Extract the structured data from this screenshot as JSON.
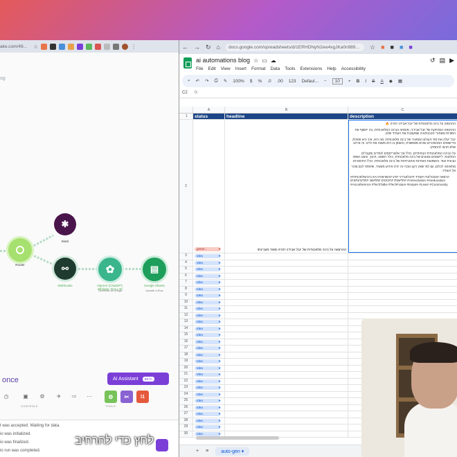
{
  "left": {
    "url_fragment": "ake.com/49...",
    "blog_fragment": "og",
    "nodes": {
      "router_label": "Router",
      "slack_label": "Slack",
      "pink_label": "Webhooks",
      "openai_label": "OpenAI (ChatGPT, Whisper, DALL-E)",
      "openai_sub": "Generate an image",
      "sheets_label": "Google Sheets",
      "sheets_sub": "Update a Row"
    },
    "run_once": "once",
    "ai_assistant": "AI Assistant",
    "beta": "BETA",
    "controls_label": "CONTROLS",
    "tools_label": "TOOLS",
    "log": [
      "t was accepted. Waiting for data.",
      "io was initialized.",
      "io was finalized.",
      "io run was completed."
    ]
  },
  "right": {
    "url": "docs.google.com/spreadsheets/d/1ERHDNyN2ew4xgJKa0n989...",
    "doc_title": "ai automations blog",
    "menus": [
      "File",
      "Edit",
      "View",
      "Insert",
      "Format",
      "Data",
      "Tools",
      "Extensions",
      "Help",
      "Accessibility"
    ],
    "zoom": "100%",
    "font": "Defaul...",
    "font_size": "10",
    "cell_ref": "C2",
    "fx": "fx",
    "columns": [
      "A",
      "B",
      "C"
    ],
    "headers": {
      "status": "status",
      "headline": "headline",
      "description": "description"
    },
    "row2_status": "gener...",
    "row2_headline": "ההרצאה על בינה מלאכותית של יובל אבידני תהיה מאוד מעניינת!",
    "desc_paragraphs": [
      "ההרצאה על בינה מלאכותית של יובל אבידני תהיה 🔥",
      "ההרצאה המרתקת של יובל אבידני, מומחה הבינה המלאכותית, בה יחשוף את הסודות מאחורי הטכנולוגיה שמעצבת את העתיד שלנו.",
      "יובל יעלה את סוד העולם המסעיר של בינה מלאכותית: מה היא, איך היא פועלת, והיישומים המהפכניים שהיא מאפשרת, והאופן בו היא משנה את חיינו. זה אירוע שלא תרצו להחמיץ!",
      "על הבינה המלאכותית הבסיסיים, כולל איך אלגוריתמים לומדים ומקבלים החלטות. ליישומים מגוונים של בינה מלאכותית, כולל רפואה, חינוך, עיצוב ושפה טבעית ועוד. והשפעות האתיות והחברתיות של בינה מלאכותית, כולל הזדמנויות.",
      "מתאימה לכולם, גם למי שאין רקע טכני! זה יהיה אירוע מעשיר, שיפתח לכם צוהר אל העתיד.",
      "#בינהמלאכותית #AI #הרצאה #טכנולוגיה #עתיד #יובלאבידני #דע #השראה #חדשנות #רובוטים #מחשוב #מדעהנתונים #AIrevolution #AIeducation #AIconference #TechTalks #TechFuture #Inspire #Learn #Community"
    ],
    "chip_idea": "Idea",
    "row_numbers": [
      "1",
      "2",
      "3",
      "4",
      "5",
      "6",
      "7",
      "8",
      "9",
      "10",
      "11",
      "12",
      "13",
      "14",
      "15",
      "16",
      "17",
      "18",
      "19",
      "20",
      "21",
      "22",
      "23",
      "24",
      "25",
      "26",
      "27",
      "28",
      "29",
      "30"
    ],
    "sheet_tab": "auto-gen"
  },
  "subtitle": "לחץ כדי להרחיב"
}
